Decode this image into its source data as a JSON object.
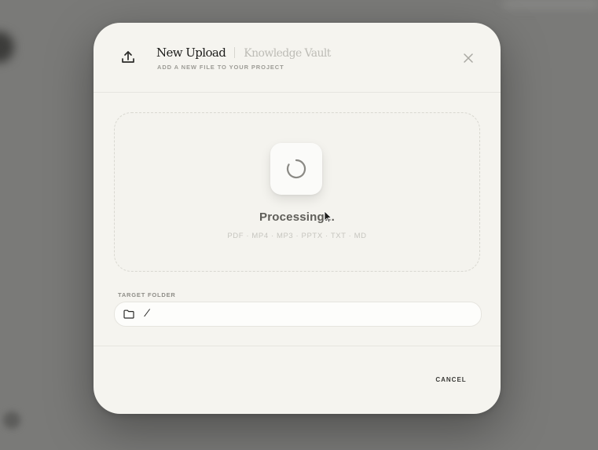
{
  "dialog": {
    "title": "New Upload",
    "brand": "Knowledge Vault",
    "caption": "ADD A NEW FILE TO YOUR PROJECT",
    "icons": {
      "upload": "upload-icon",
      "close": "close-icon"
    }
  },
  "dropzone": {
    "status": "Processing...",
    "formats": "PDF · MP4 · MP3 · PPTX · TXT · MD",
    "icon": "spinner-icon"
  },
  "target_folder": {
    "label": "TARGET FOLDER",
    "value": "/",
    "icon": "folder-icon"
  },
  "footer": {
    "cancel_label": "CANCEL"
  },
  "colors": {
    "backdrop": "#7a7a78",
    "modal_bg": "#f5f4ef",
    "text_primary": "#1d1d1b",
    "text_muted": "#9c9b95"
  }
}
